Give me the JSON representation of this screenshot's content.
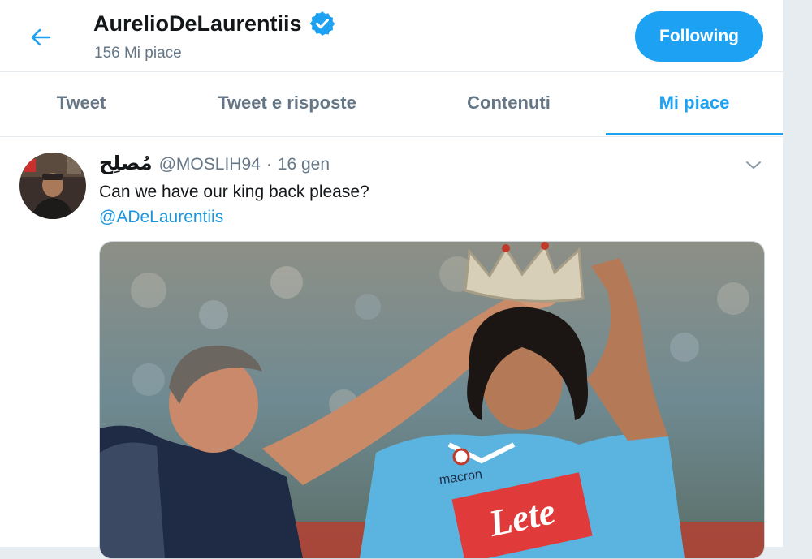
{
  "header": {
    "name": "AurelioDeLaurentiis",
    "subtitle": "156 Mi piace",
    "follow_label": "Following"
  },
  "tabs": [
    {
      "label": "Tweet",
      "active": false
    },
    {
      "label": "Tweet e risposte",
      "active": false
    },
    {
      "label": "Contenuti",
      "active": false
    },
    {
      "label": "Mi piace",
      "active": true
    }
  ],
  "tweet": {
    "display_name": "مُصلِح",
    "handle": "@MOSLIH94",
    "separator": "·",
    "date": "16 gen",
    "text": "Can we have our king back please?",
    "mention": "@ADeLaurentiis",
    "media": {
      "sponsor_top": "macron",
      "sponsor_main": "Lete"
    }
  },
  "colors": {
    "accent": "#1da1f2",
    "text": "#14171a",
    "muted": "#657786",
    "border": "#e6ecf0"
  },
  "icons": {
    "back": "back-arrow-icon",
    "verified": "verified-badge-icon",
    "caret": "chevron-down-icon"
  }
}
